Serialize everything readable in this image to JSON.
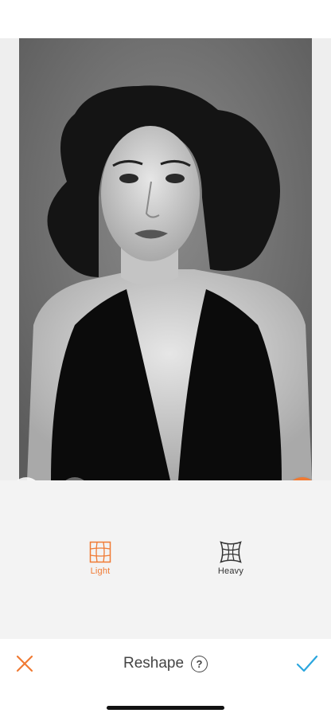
{
  "editor": {
    "image_alt": "Black and white portrait photo of a woman with voluminous curly hair wearing a dark plunging halter top",
    "undo_icon": "undo-arrow-icon",
    "redo_icon": "redo-arrow-icon",
    "compare_icon": "compare-split-icon"
  },
  "tools": [
    {
      "label": "Light",
      "icon": "grid-warp-light-icon",
      "selected": true
    },
    {
      "label": "Heavy",
      "icon": "grid-warp-heavy-icon",
      "selected": false
    }
  ],
  "bottom_bar": {
    "title": "Reshape",
    "help_symbol": "?",
    "cancel_icon": "close-icon",
    "confirm_icon": "checkmark-icon"
  },
  "colors": {
    "accent": "#f07a33",
    "confirm": "#2ba6de",
    "tool_background": "#f3f3f3"
  }
}
